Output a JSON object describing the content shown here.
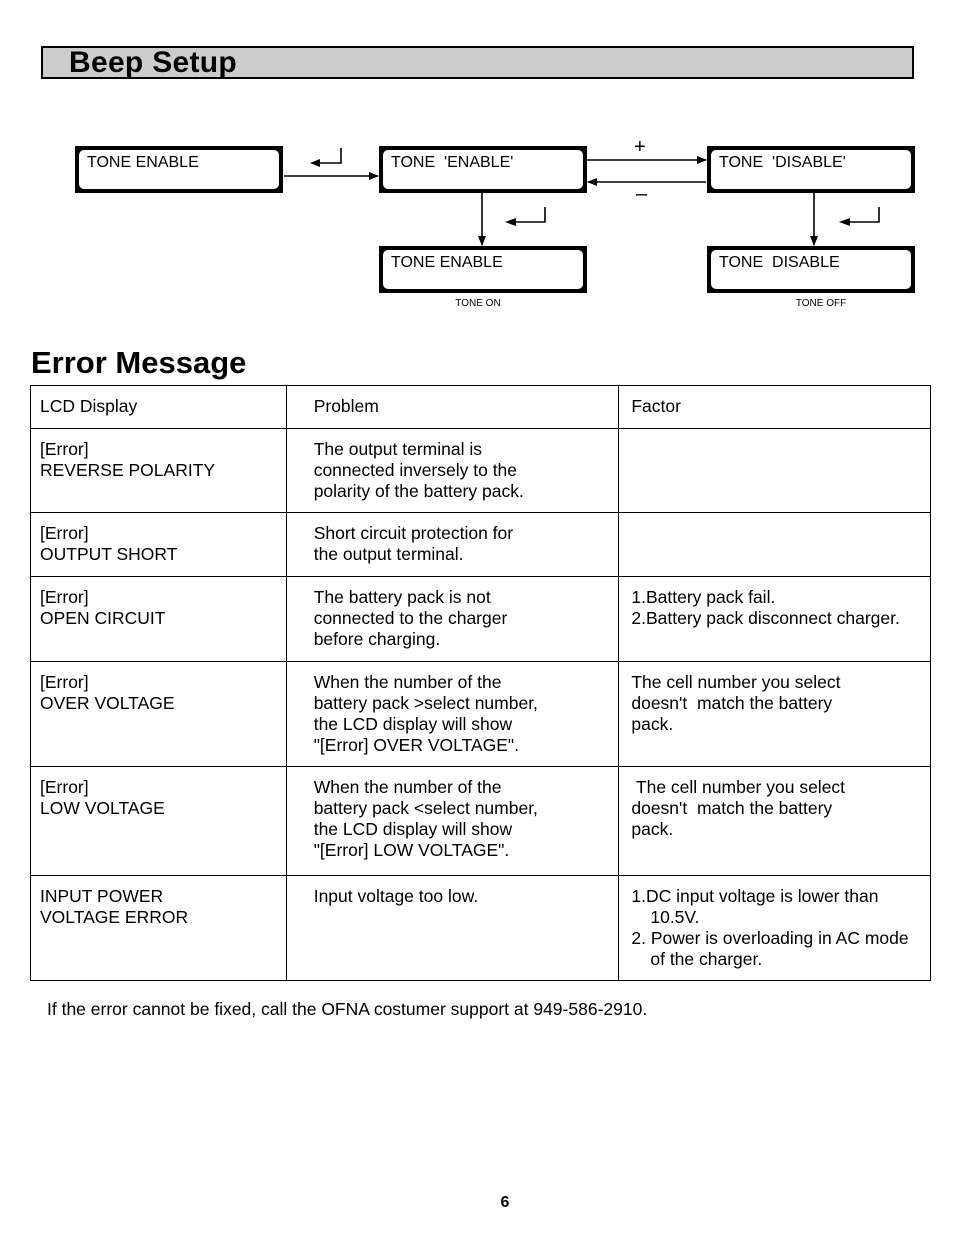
{
  "beep_setup": {
    "title": "Beep Setup",
    "boxes": {
      "start": "TONE ENABLE",
      "select_enable": "TONE  'ENABLE'",
      "select_disable": "TONE  'DISABLE'",
      "result_enable": "TONE ENABLE",
      "result_disable": "TONE  DISABLE"
    },
    "captions": {
      "tone_on": "TONE ON",
      "tone_off": "TONE OFF"
    },
    "signs": {
      "plus": "+",
      "minus": "–"
    },
    "icons": {
      "enter": "enter-key-icon"
    }
  },
  "error_message": {
    "title": "Error Message",
    "headers": [
      "LCD Display",
      "Problem",
      "Factor"
    ],
    "rows": [
      {
        "lcd": [
          "[Error]",
          "REVERSE POLARITY"
        ],
        "problem": [
          "The output terminal is",
          "connected inversely to the",
          "polarity of the battery pack."
        ],
        "factor": []
      },
      {
        "lcd": [
          "[Error]",
          "OUTPUT SHORT"
        ],
        "problem": [
          "Short circuit protection for",
          "the output terminal."
        ],
        "factor": []
      },
      {
        "lcd": [
          "[Error]",
          "OPEN CIRCUIT"
        ],
        "problem": [
          "The battery pack is not",
          "connected to the charger",
          "before charging."
        ],
        "factor": [
          "1.Battery pack fail.",
          "2.Battery pack disconnect charger."
        ]
      },
      {
        "lcd": [
          "[Error]",
          "OVER VOLTAGE"
        ],
        "problem": [
          "When the number of the",
          "battery pack >select number,",
          "the LCD display will show",
          "\"[Error] OVER VOLTAGE\"."
        ],
        "factor": [
          "The cell number you select",
          "doesn't  match the battery",
          "pack."
        ]
      },
      {
        "lcd": [
          "[Error]",
          "LOW VOLTAGE"
        ],
        "problem": [
          "When the number of the",
          "battery pack <select number,",
          "the LCD display will show",
          "\"[Error] LOW VOLTAGE\"."
        ],
        "factor": [
          " The cell number you select",
          "doesn't  match the battery",
          "pack."
        ]
      },
      {
        "lcd": [
          "INPUT POWER",
          "VOLTAGE ERROR"
        ],
        "problem": [
          "Input voltage too low."
        ],
        "factor": [
          "1.DC input voltage is lower than 10.5V.",
          "2. Power is overloading in AC mode of the charger."
        ]
      }
    ]
  },
  "footer_note": "If the error cannot be fixed, call the OFNA costumer support at 949-586-2910.",
  "page_number": "6"
}
